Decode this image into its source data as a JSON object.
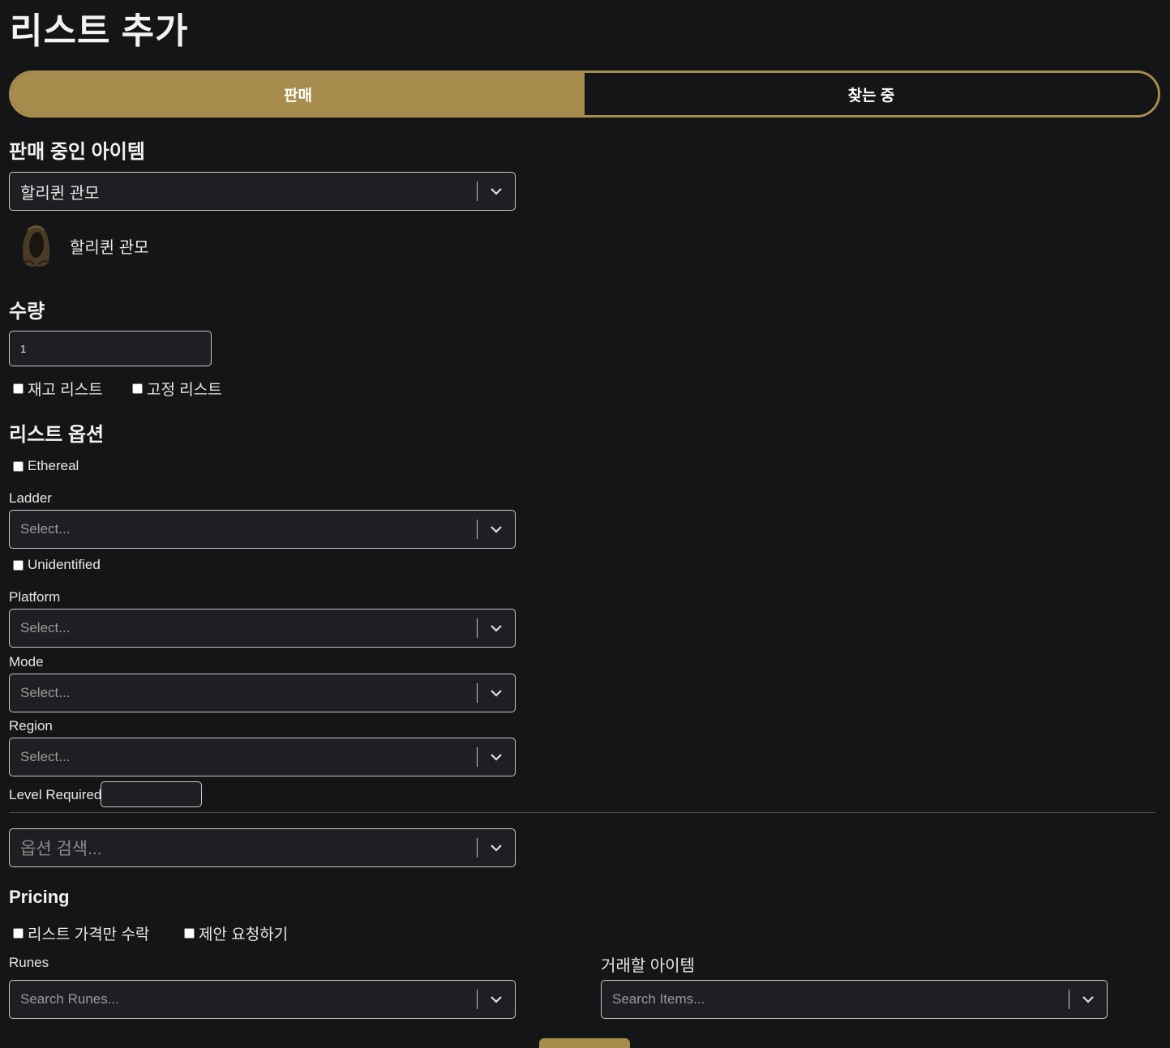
{
  "page": {
    "title": "리스트 추가"
  },
  "mode_toggle": {
    "sell_label": "판매",
    "buy_label": "찾는 중",
    "active": "sell"
  },
  "item_section": {
    "heading": "판매 중인 아이템",
    "selected_value": "할리퀸 관모",
    "preview_name": "할리퀸 관모",
    "preview_icon": "hood-helmet-icon"
  },
  "quantity": {
    "heading": "수량",
    "value": "1",
    "stock_label": "재고 리스트",
    "fixed_label": "고정 리스트"
  },
  "options": {
    "heading": "리스트 옵션",
    "ethereal_label": "Ethereal",
    "ladder_label": "Ladder",
    "ladder_placeholder": "Select...",
    "unidentified_label": "Unidentified",
    "platform_label": "Platform",
    "platform_placeholder": "Select...",
    "mode_label": "Mode",
    "mode_placeholder": "Select...",
    "region_label": "Region",
    "region_placeholder": "Select...",
    "level_label": "Level Required",
    "search_placeholder": "옵션 검색..."
  },
  "pricing": {
    "heading": "Pricing",
    "list_price_only_label": "리스트 가격만 수락",
    "request_offer_label": "제안 요청하기",
    "runes_label": "Runes",
    "runes_placeholder": "Search Runes...",
    "trade_items_label": "거래할 아이템",
    "trade_items_placeholder": "Search Items..."
  },
  "colors": {
    "accent": "#a88c4e",
    "background": "#141517",
    "field": "#1e1f22"
  }
}
